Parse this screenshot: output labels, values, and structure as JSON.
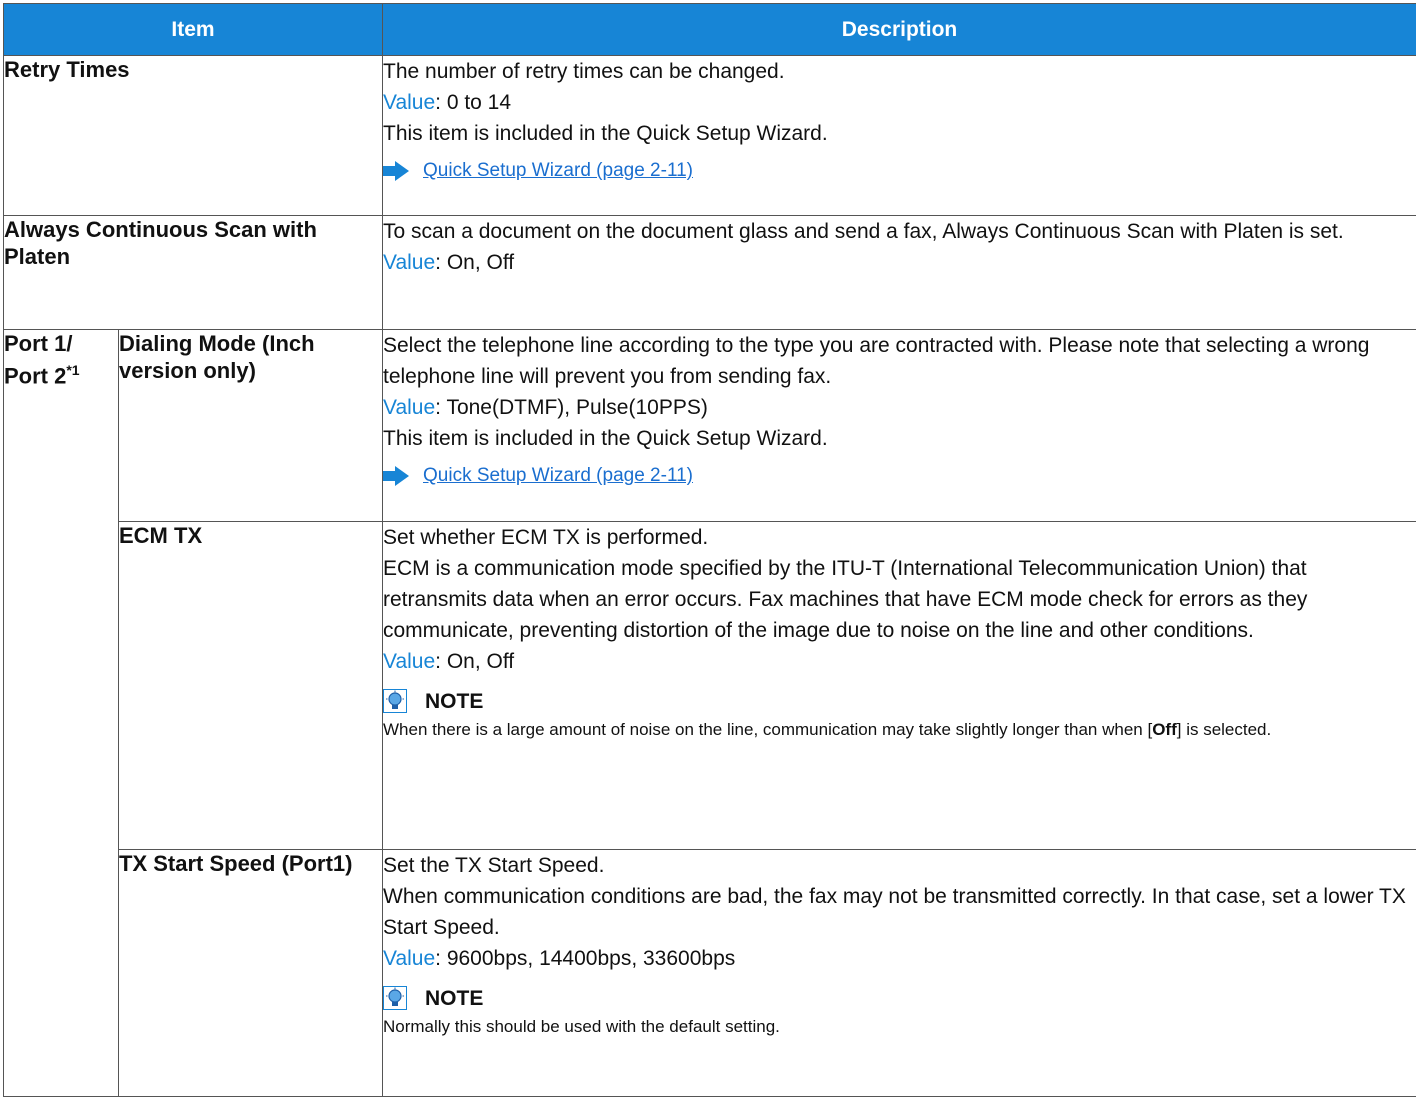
{
  "header": {
    "item": "Item",
    "description": "Description"
  },
  "rows": {
    "retry": {
      "item": "Retry Times",
      "line1": "The number of retry times can be changed.",
      "value_label": "Value",
      "value": ": 0 to 14",
      "line3": "This item is included in the Quick Setup Wizard.",
      "link": "Quick Setup Wizard (page 2-11)"
    },
    "platen": {
      "item": "Always Continuous Scan with Platen",
      "line1": "To scan a document on the document glass and send a fax, Always Continuous Scan with Platen is set.",
      "value_label": "Value",
      "value": ": On, Off"
    },
    "port": {
      "label": "Port 1/ Port 2",
      "footnote": "*1"
    },
    "dialing": {
      "item": "Dialing Mode (Inch version only)",
      "line1": "Select the telephone line according to the type you are contracted with. Please note that selecting a wrong telephone line will prevent you from sending fax.",
      "value_label": "Value",
      "value": ": Tone(DTMF), Pulse(10PPS)",
      "line3": "This item is included in the Quick Setup Wizard.",
      "link": "Quick Setup Wizard (page 2-11)"
    },
    "ecm": {
      "item": "ECM TX",
      "line1": "Set whether ECM TX is performed.",
      "line2": "ECM is a communication mode specified by the ITU-T (International Telecommunication Union) that retransmits data when an error occurs. Fax machines that have ECM mode check for errors as they communicate, preventing distortion of the image due to noise on the line and other conditions.",
      "value_label": "Value",
      "value": ": On, Off",
      "note_title": "NOTE",
      "note_pre": "When there is a large amount of noise on the line, communication may take slightly longer than when [",
      "note_bold": "Off",
      "note_post": "] is selected."
    },
    "txspeed": {
      "item": "TX Start Speed (Port1)",
      "line1": "Set the TX Start Speed.",
      "line2": "When communication conditions are bad, the fax may not be transmitted correctly. In that case, set a lower TX Start Speed.",
      "value_label": "Value",
      "value": ": 9600bps, 14400bps, 33600bps",
      "note_title": "NOTE",
      "note_text": "Normally this should be used with the default setting."
    }
  },
  "colors": {
    "header_bg": "#1785d6",
    "value_label": "#1785d6",
    "link": "#1a6ecf"
  },
  "icons": {
    "link_arrow": "right-arrow-icon",
    "note": "lightbulb-note-icon"
  }
}
